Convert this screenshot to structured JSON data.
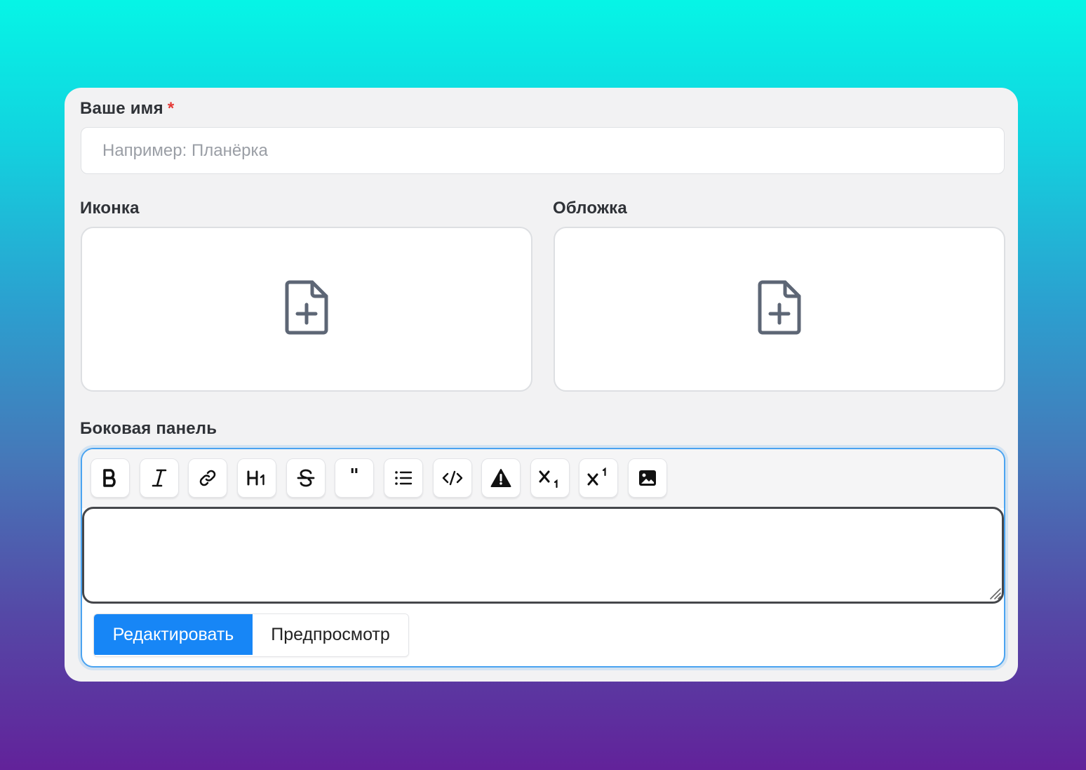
{
  "form": {
    "name_label": "Ваше имя",
    "required_mark": "*",
    "name_placeholder": "Например: Планёрка",
    "name_value": "",
    "icon_label": "Иконка",
    "cover_label": "Обложка",
    "sidebar_label": "Боковая панель"
  },
  "icons": {
    "dropzone": "file-plus-icon"
  },
  "toolbar": {
    "quote_glyph": "\"",
    "buttons": [
      {
        "name": "bold",
        "icon": "bold-icon"
      },
      {
        "name": "italic",
        "icon": "italic-icon"
      },
      {
        "name": "link",
        "icon": "link-icon"
      },
      {
        "name": "heading",
        "icon": "heading-icon"
      },
      {
        "name": "strikethrough",
        "icon": "strikethrough-icon"
      },
      {
        "name": "quote",
        "icon": "quote-icon"
      },
      {
        "name": "bulleted-list",
        "icon": "list-icon"
      },
      {
        "name": "code",
        "icon": "code-icon"
      },
      {
        "name": "warning",
        "icon": "warning-icon"
      },
      {
        "name": "subscript",
        "icon": "subscript-icon"
      },
      {
        "name": "superscript",
        "icon": "superscript-icon"
      },
      {
        "name": "image",
        "icon": "image-icon"
      }
    ]
  },
  "editor": {
    "content": ""
  },
  "tabs": {
    "edit": "Редактировать",
    "preview": "Предпросмотр",
    "active": "edit"
  },
  "colors": {
    "accent": "#1786f6",
    "required": "#e53935",
    "focus_border": "#4aa3f0",
    "icon_gray": "#5d6675"
  }
}
